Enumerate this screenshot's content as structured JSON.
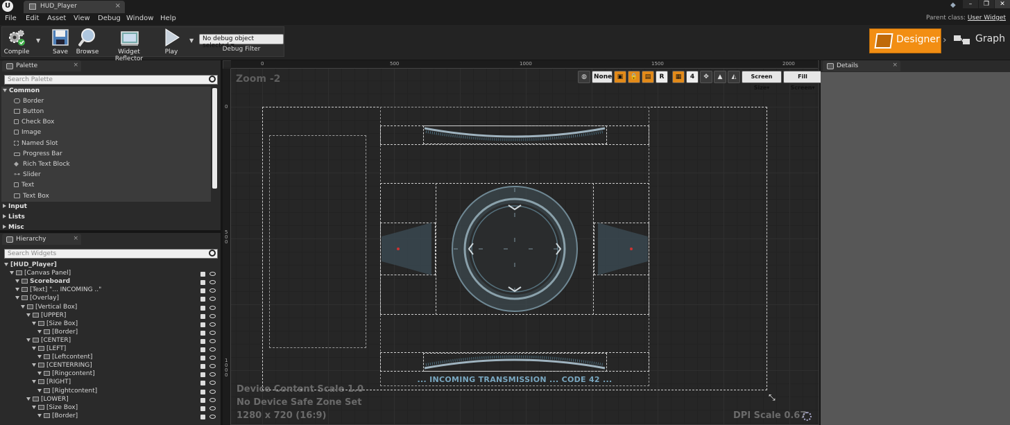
{
  "window": {
    "tab_title": "HUD_Player",
    "controls": [
      "–",
      "❐",
      "✕"
    ]
  },
  "menu": [
    "File",
    "Edit",
    "Asset",
    "View",
    "Debug",
    "Window",
    "Help"
  ],
  "parent_class": {
    "label": "Parent class:",
    "value": "User Widget"
  },
  "toolbar": {
    "compile": "Compile",
    "save": "Save",
    "browse": "Browse",
    "widget_reflector": "Widget Reflector",
    "play": "Play",
    "debug_object": "No debug object selected",
    "debug_filter": "Debug Filter"
  },
  "modes": {
    "designer": "Designer",
    "graph": "Graph"
  },
  "palette": {
    "tab": "Palette",
    "search_placeholder": "Search Palette",
    "common": "Common",
    "items": [
      "Border",
      "Button",
      "Check Box",
      "Image",
      "Named Slot",
      "Progress Bar",
      "Rich Text Block",
      "Slider",
      "Text",
      "Text Box"
    ],
    "categories": [
      "Input",
      "Lists",
      "Misc"
    ]
  },
  "hierarchy": {
    "tab": "Hierarchy",
    "search_placeholder": "Search Widgets",
    "rows": [
      {
        "label": "[HUD_Player]",
        "depth": 0
      },
      {
        "label": "[Canvas Panel]",
        "depth": 1
      },
      {
        "label": "Scoreboard",
        "depth": 2
      },
      {
        "label": "[Text] \"... INCOMING ..\"",
        "depth": 2
      },
      {
        "label": "[Overlay]",
        "depth": 2
      },
      {
        "label": "[Vertical Box]",
        "depth": 3
      },
      {
        "label": "[UPPER]",
        "depth": 4
      },
      {
        "label": "[Size Box]",
        "depth": 5
      },
      {
        "label": "[Border]",
        "depth": 6
      },
      {
        "label": "[CENTER]",
        "depth": 4
      },
      {
        "label": "[LEFT]",
        "depth": 5
      },
      {
        "label": "[Leftcontent]",
        "depth": 6
      },
      {
        "label": "[CENTERRING]",
        "depth": 5
      },
      {
        "label": "[Ringcontent]",
        "depth": 6
      },
      {
        "label": "[RIGHT]",
        "depth": 5
      },
      {
        "label": "[Rightcontent]",
        "depth": 6
      },
      {
        "label": "[LOWER]",
        "depth": 4
      },
      {
        "label": "[Size Box]",
        "depth": 5
      },
      {
        "label": "[Border]",
        "depth": 6
      }
    ]
  },
  "designer": {
    "zoom": "Zoom -2",
    "ruler_top": [
      "0",
      "500",
      "1000",
      "1500",
      "2000"
    ],
    "ruler_left": [
      "0",
      "500",
      "1000"
    ],
    "vp_none": "None",
    "vp_r": "R",
    "vp_grid": "4",
    "screen_size": "Screen Size",
    "fill_screen": "Fill Screen",
    "device_content_scale": "Device Content Scale 1.0",
    "safe_zone": "No Device Safe Zone Set",
    "resolution": "1280 x 720 (16:9)",
    "dpi_scale": "DPI Scale 0.67",
    "incoming_text": "... INCOMING TRANSMISSION ... CODE 42 ..."
  },
  "details": {
    "tab": "Details"
  }
}
